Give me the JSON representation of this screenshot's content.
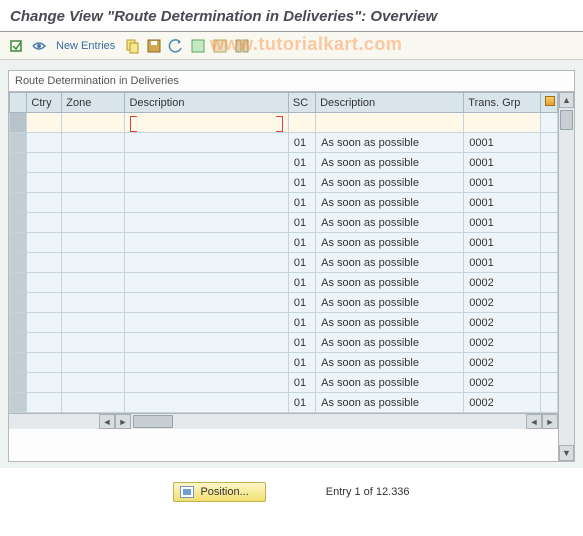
{
  "title": "Change View \"Route Determination in Deliveries\": Overview",
  "toolbar": {
    "new_entries": "New Entries"
  },
  "watermark": "www.tutorialkart.com",
  "panel_title": "Route Determination in Deliveries",
  "columns": {
    "ctry": "Ctry",
    "zone": "Zone",
    "desc1": "Description",
    "sc": "SC",
    "desc2": "Description",
    "trans": "Trans. Grp"
  },
  "rows": [
    {
      "ctry": "",
      "zone": "",
      "desc1": "",
      "sc": "",
      "desc2": "",
      "trans": "",
      "edit": true
    },
    {
      "ctry": "",
      "zone": "",
      "desc1": "",
      "sc": "01",
      "desc2": "As soon as possible",
      "trans": "0001"
    },
    {
      "ctry": "",
      "zone": "",
      "desc1": "",
      "sc": "01",
      "desc2": "As soon as possible",
      "trans": "0001"
    },
    {
      "ctry": "",
      "zone": "",
      "desc1": "",
      "sc": "01",
      "desc2": "As soon as possible",
      "trans": "0001"
    },
    {
      "ctry": "",
      "zone": "",
      "desc1": "",
      "sc": "01",
      "desc2": "As soon as possible",
      "trans": "0001"
    },
    {
      "ctry": "",
      "zone": "",
      "desc1": "",
      "sc": "01",
      "desc2": "As soon as possible",
      "trans": "0001"
    },
    {
      "ctry": "",
      "zone": "",
      "desc1": "",
      "sc": "01",
      "desc2": "As soon as possible",
      "trans": "0001"
    },
    {
      "ctry": "",
      "zone": "",
      "desc1": "",
      "sc": "01",
      "desc2": "As soon as possible",
      "trans": "0001"
    },
    {
      "ctry": "",
      "zone": "",
      "desc1": "",
      "sc": "01",
      "desc2": "As soon as possible",
      "trans": "0002"
    },
    {
      "ctry": "",
      "zone": "",
      "desc1": "",
      "sc": "01",
      "desc2": "As soon as possible",
      "trans": "0002"
    },
    {
      "ctry": "",
      "zone": "",
      "desc1": "",
      "sc": "01",
      "desc2": "As soon as possible",
      "trans": "0002"
    },
    {
      "ctry": "",
      "zone": "",
      "desc1": "",
      "sc": "01",
      "desc2": "As soon as possible",
      "trans": "0002"
    },
    {
      "ctry": "",
      "zone": "",
      "desc1": "",
      "sc": "01",
      "desc2": "As soon as possible",
      "trans": "0002"
    },
    {
      "ctry": "",
      "zone": "",
      "desc1": "",
      "sc": "01",
      "desc2": "As soon as possible",
      "trans": "0002"
    },
    {
      "ctry": "",
      "zone": "",
      "desc1": "",
      "sc": "01",
      "desc2": "As soon as possible",
      "trans": "0002"
    }
  ],
  "footer": {
    "position_label": "Position...",
    "entry_text": "Entry 1 of 12.336"
  }
}
